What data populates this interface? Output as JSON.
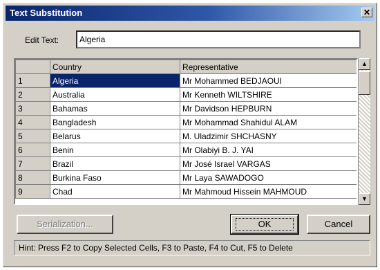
{
  "window": {
    "title": "Text Substitution",
    "close_glyph": "✕"
  },
  "edit": {
    "label": "Edit Text:",
    "value": "Algeria"
  },
  "grid": {
    "columns": [
      "",
      "Country",
      "Representative"
    ],
    "rows": [
      {
        "num": "1",
        "country": "Algeria",
        "rep": "Mr Mohammed BEDJAOUI",
        "selected": true
      },
      {
        "num": "2",
        "country": "Australia",
        "rep": "Mr Kenneth WILTSHIRE"
      },
      {
        "num": "3",
        "country": "Bahamas",
        "rep": "Mr Davidson HEPBURN"
      },
      {
        "num": "4",
        "country": "Bangladesh",
        "rep": "Mr Mohammad Shahidul ALAM"
      },
      {
        "num": "5",
        "country": "Belarus",
        "rep": "M. Uladzimir SHCHASNY"
      },
      {
        "num": "6",
        "country": "Benin",
        "rep": "Mr Olabiyi B. J. YAI"
      },
      {
        "num": "7",
        "country": "Brazil",
        "rep": "Mr José Israel VARGAS"
      },
      {
        "num": "8",
        "country": "Burkina Faso",
        "rep": "Mr Laya SAWADOGO"
      },
      {
        "num": "9",
        "country": "Chad",
        "rep": "Mr Mahmoud Hissein MAHMOUD"
      }
    ]
  },
  "scrollbar": {
    "up_glyph": "▲",
    "down_glyph": "▼"
  },
  "buttons": {
    "serialization": "Serialization...",
    "ok": "OK",
    "cancel": "Cancel"
  },
  "hint": "Hint: Press F2 to Copy Selected Cells, F3 to Paste, F4 to Cut, F5 to Delete",
  "colors": {
    "titlebar": "#0a246a",
    "selection": "#0a246a",
    "face": "#d4d0c8"
  }
}
